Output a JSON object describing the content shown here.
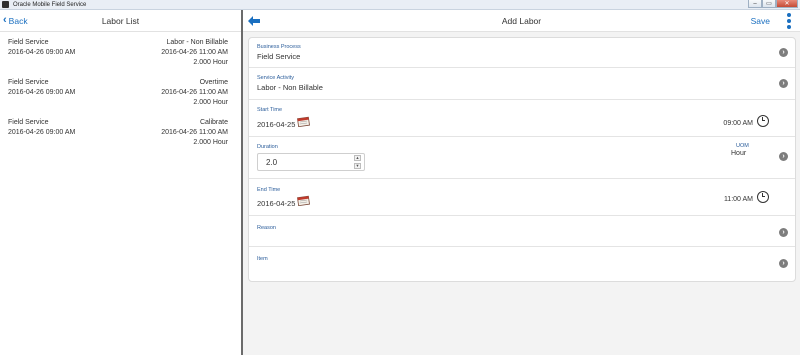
{
  "window": {
    "title": "Oracle Mobile Field Service",
    "minimize": "–",
    "maximize": "▭",
    "close": "✕"
  },
  "left": {
    "back_label": "Back",
    "title": "Labor List",
    "items": [
      {
        "process": "Field Service",
        "start": "2016-04-26 09:00 AM",
        "activity": "Labor - Non Billable",
        "end": "2016-04-26 11:00 AM",
        "qty": "2.000 Hour"
      },
      {
        "process": "Field Service",
        "start": "2016-04-26 09:00 AM",
        "activity": "Overtime",
        "end": "2016-04-26 11:00 AM",
        "qty": "2.000 Hour"
      },
      {
        "process": "Field Service",
        "start": "2016-04-26 09:00 AM",
        "activity": "Calibrate",
        "end": "2016-04-26 11:00 AM",
        "qty": "2.000 Hour"
      }
    ]
  },
  "right": {
    "title": "Add Labor",
    "save_label": "Save",
    "form": {
      "business_process_label": "Business Process",
      "business_process_value": "Field Service",
      "service_activity_label": "Service Activity",
      "service_activity_value": "Labor - Non Billable",
      "start_time_label": "Start Time",
      "start_date": "2016-04-25",
      "start_time": "09:00 AM",
      "duration_label": "Duration",
      "duration_value": "2.0",
      "uom_label": "UOM",
      "uom_value": "Hour",
      "end_time_label": "End Time",
      "end_date": "2016-04-25",
      "end_time": "11:00 AM",
      "reason_label": "Reason",
      "item_label": "Item"
    }
  },
  "icons": {
    "back_arrow": "arrow-left-icon",
    "chevron": "chevron-right-icon",
    "calendar": "calendar-icon",
    "clock": "clock-icon",
    "more": "more-vertical-icon"
  },
  "colors": {
    "accent": "#1a6fc0",
    "label": "#2a5c9a",
    "chevron": "#7d7d7d",
    "pane_bg": "#f3f3f3"
  }
}
